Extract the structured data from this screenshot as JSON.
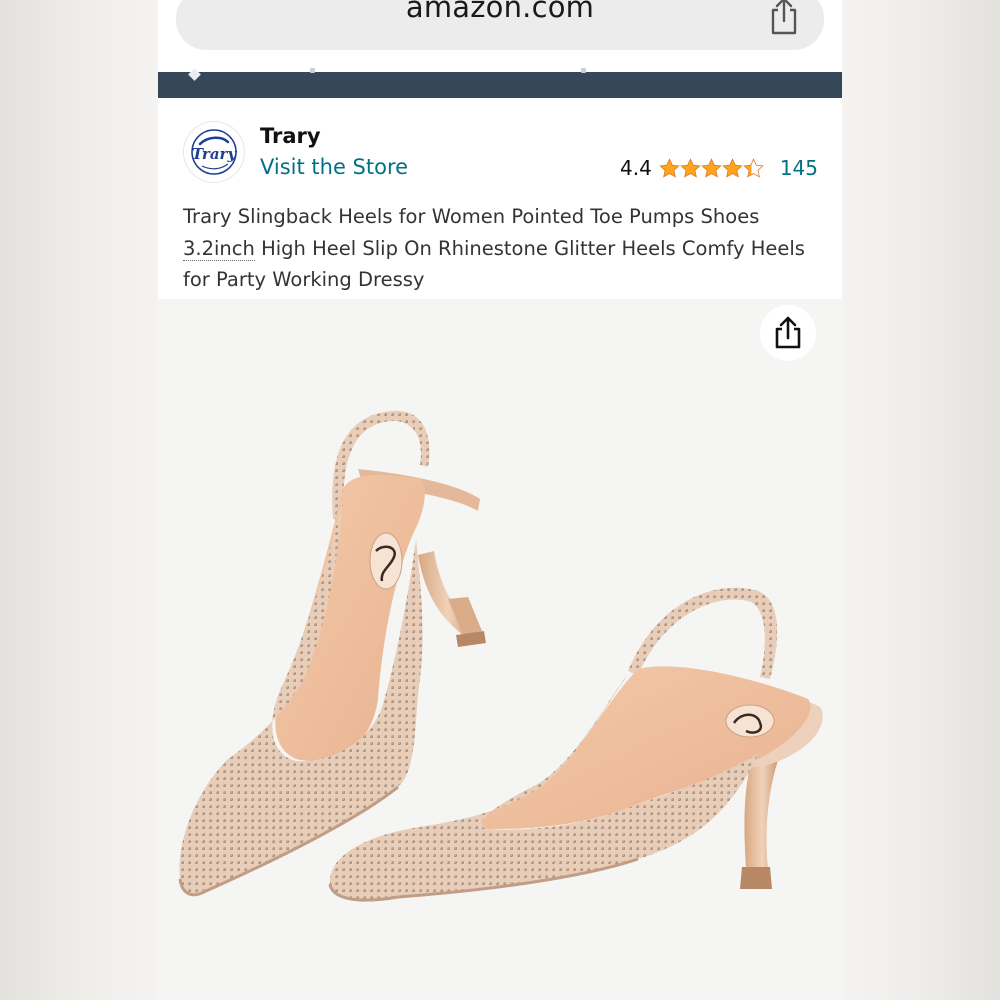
{
  "browser": {
    "url": "amazon.com",
    "share_icon": "share-icon"
  },
  "store": {
    "logo_text": "Trary",
    "brand": "Trary",
    "visit_label": "Visit the Store",
    "rating_value": "4.4",
    "rating_stars": 4.4,
    "rating_count": "145"
  },
  "product": {
    "title_part1": "Trary Slingback Heels for Women Pointed Toe Pumps Shoes",
    "title_underlined": "3.2inch",
    "title_part2": " High Heel Slip On Rhinestone Glitter Heels Comfy Heels for Party Working Dressy",
    "image_subject": "pair of nude rhinestone slingback pointed-toe heels"
  },
  "colors": {
    "link": "#007185",
    "star": "#ffa41c",
    "nav": "#37475a"
  }
}
